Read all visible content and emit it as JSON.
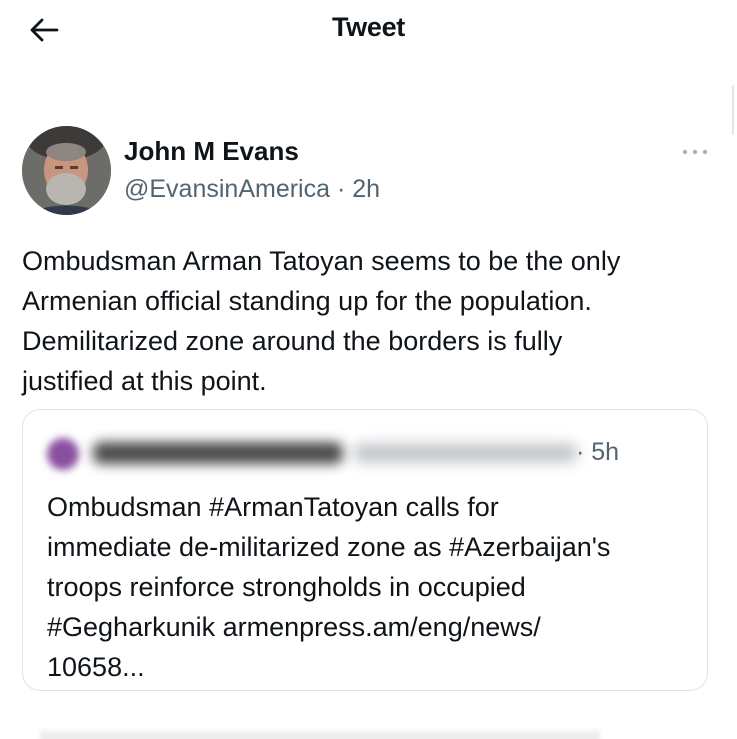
{
  "header": {
    "title": "Tweet"
  },
  "tweet": {
    "author_name": "John M Evans",
    "author_handle": "@EvansinAmerica",
    "separator": "·",
    "time": "2h",
    "text_lines": [
      "Ombudsman Arman Tatoyan seems to be the only",
      "Armenian official standing up for the population.",
      "Demilitarized zone around the borders is fully",
      "justified at this point."
    ]
  },
  "quote": {
    "time": "· 5h",
    "text_lines": [
      "Ombudsman #ArmanTatoyan calls for",
      "immediate de-militarized zone as #Azerbaijan's",
      "troops reinforce strongholds in occupied",
      "#Gegharkunik armenpress.am/eng/news/",
      "10658..."
    ]
  },
  "icons": {
    "back": "arrow-left-icon",
    "more": "more-dots-icon"
  },
  "colors": {
    "text_primary": "#0f1419",
    "text_secondary": "#536471",
    "border": "#dfe3e6"
  }
}
